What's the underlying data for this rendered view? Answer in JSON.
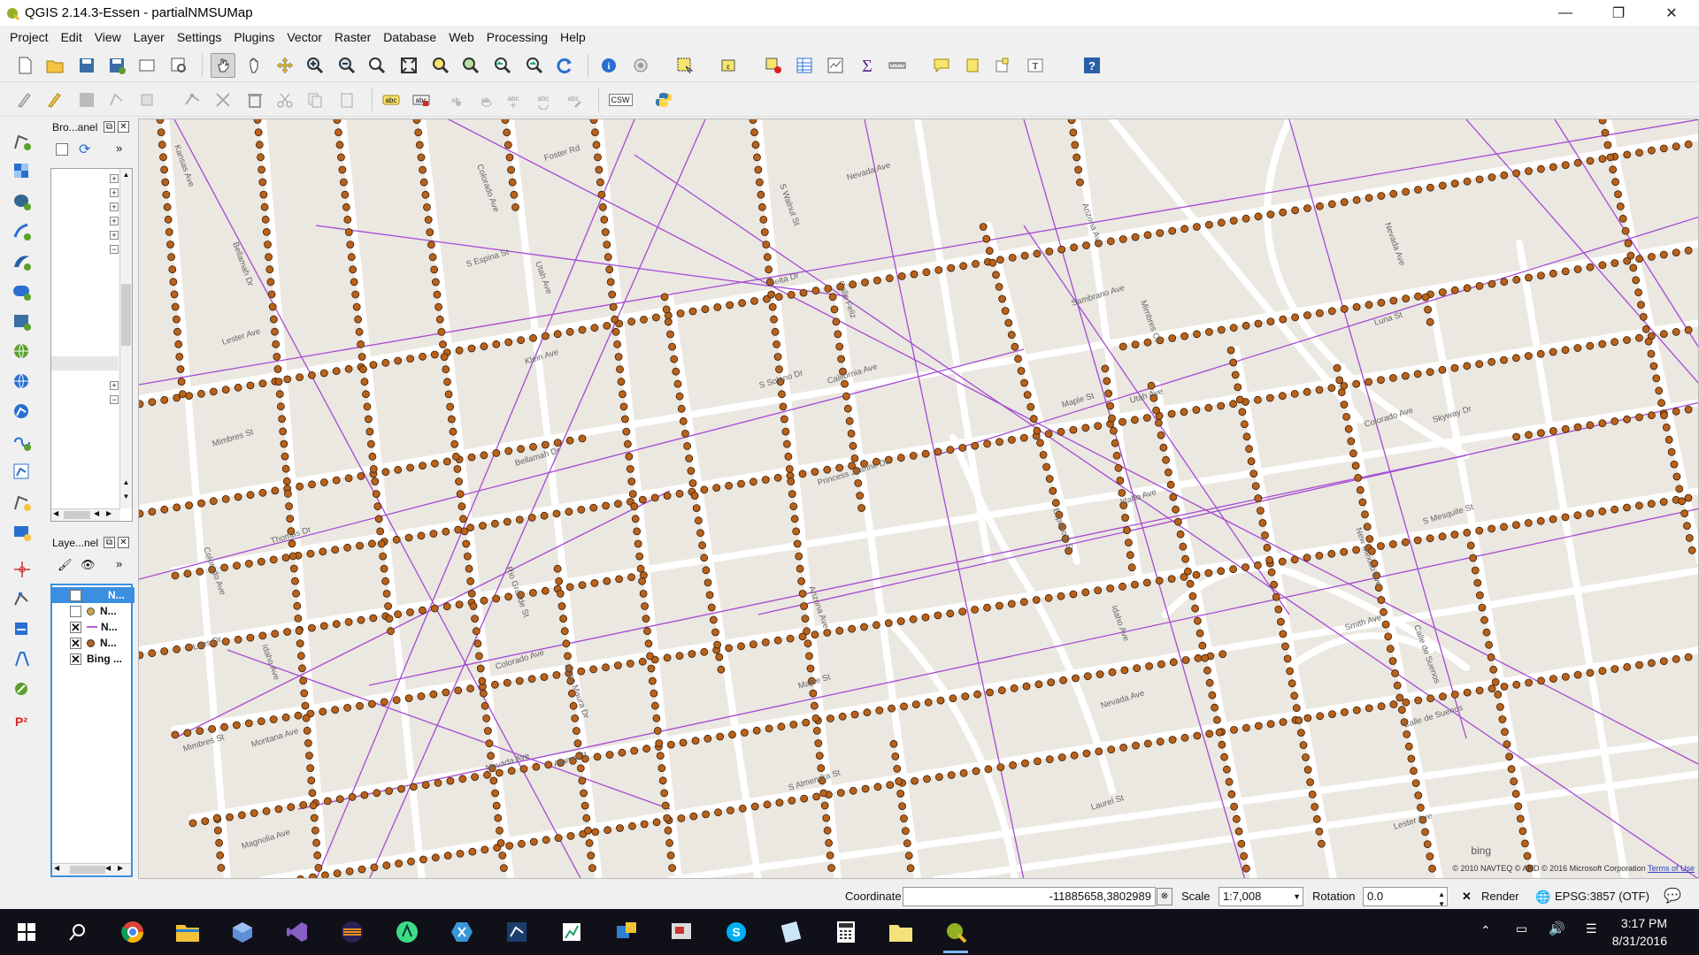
{
  "window": {
    "title": "QGIS 2.14.3-Essen - partialNMSUMap"
  },
  "menu": [
    "Project",
    "Edit",
    "View",
    "Layer",
    "Settings",
    "Plugins",
    "Vector",
    "Raster",
    "Database",
    "Web",
    "Processing",
    "Help"
  ],
  "toolbar2": {
    "csw_label": "CSW"
  },
  "browser_panel": {
    "title": "Bro...anel"
  },
  "layers_panel": {
    "title": "Laye...nel",
    "layers": [
      {
        "name": "N...",
        "checked": false,
        "selected": true
      },
      {
        "name": "N...",
        "checked": false,
        "symbol": "point"
      },
      {
        "name": "N...",
        "checked": true,
        "symbol": "line"
      },
      {
        "name": "N...",
        "checked": true,
        "symbol": "point"
      },
      {
        "name": "Bing ...",
        "checked": true
      }
    ]
  },
  "map": {
    "attribution": "© 2010 NAVTEQ © AND © 2016 Microsoft Corporation",
    "terms": "Terms of Use",
    "bing": "bing",
    "street_labels": [
      "Kansas Ave",
      "S Espina St",
      "S Solano Dr",
      "Espanola St",
      "Smith Ave",
      "Mimbres St",
      "Colorado Ave",
      "Delta Dr",
      "Maple St",
      "New Mexico Ave",
      "Lees Dr",
      "Nevada Ave",
      "S Walnut St",
      "Sambrano Ave",
      "Colorado Ave",
      "Colorado Ave",
      "Colorado Ave",
      "S Almendra St",
      "Arizona Ave",
      "Luna St",
      "Mimbres St",
      "Rio Grande St",
      "Maple St",
      "Laurel St",
      "Nevada Ave",
      "Lester Ave",
      "Bellamah Dr",
      "Arizona Ave",
      "Nevada Ave",
      "Lester Ave",
      "Bellamah Dr",
      "Klein Ave",
      "Princess Jeanne Dr",
      "Idaho Ave",
      "Calle de Suenos",
      "Magnolia Ave",
      "Utah Ave",
      "California Ave",
      "Idaho Ave",
      "Calle de Suenos",
      "Montana Ave",
      "Foster Rd",
      "Calle Feliz",
      "Utah Ave",
      "S Mesquite St",
      "Idaho Ave",
      "Alamo St",
      "Nevada Ave",
      "Mimbres Ct",
      "Skyway Dr",
      "Thomas Dr",
      "Dana Maura Dr"
    ]
  },
  "status": {
    "coordinate_label": "Coordinate",
    "coordinate_value": "-11885658,3802989",
    "scale_label": "Scale",
    "scale_value": "1:7,008",
    "rotation_label": "Rotation",
    "rotation_value": "0.0",
    "render_label": "Render",
    "render_checked": true,
    "crs": "EPSG:3857 (OTF)"
  },
  "taskbar": {
    "time": "3:17 PM",
    "date": "8/31/2016"
  }
}
